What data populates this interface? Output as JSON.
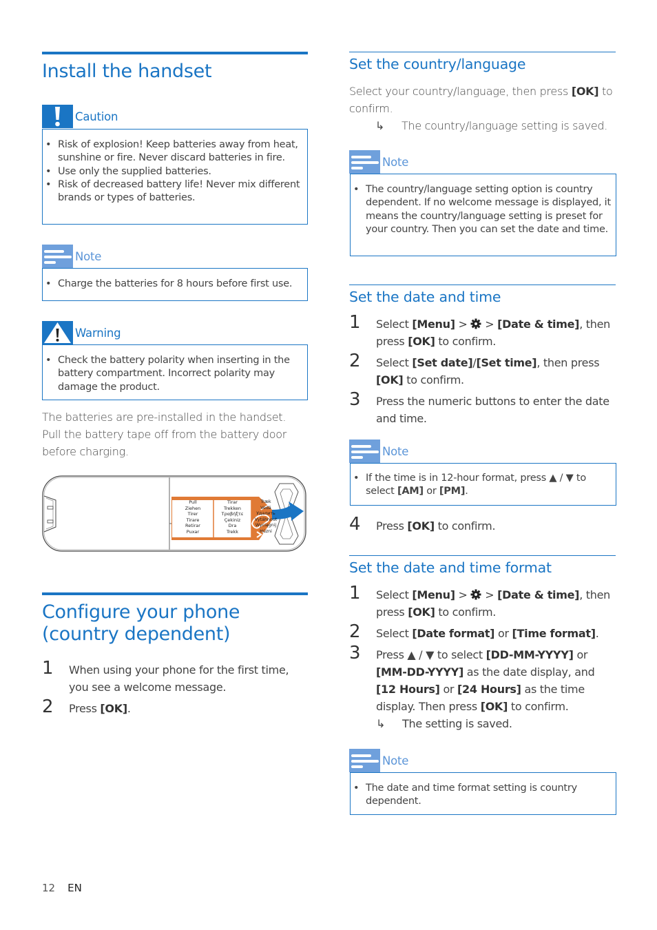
{
  "install": {
    "title": "Install the handset",
    "caution": {
      "label": "Caution",
      "items": [
        "Risk of explosion! Keep batteries away from heat, sunshine or fire. Never discard batteries in fire.",
        "Use only the supplied batteries.",
        "Risk of decreased battery life! Never mix different brands or types of batteries."
      ]
    },
    "note": {
      "label": "Note",
      "items": [
        "Charge the batteries for 8 hours before first use."
      ]
    },
    "warning": {
      "label": "Warning",
      "items": [
        "Check the battery polarity when inserting in the battery compartment. Incorrect polarity may damage the product."
      ]
    },
    "paragraph": "The batteries are pre-installed in the handset. Pull the battery tape off from the battery door before charging.",
    "tape_labels": {
      "col1": [
        "Pull",
        "Ziehen",
        "Tirer",
        "Tirare",
        "Retirar",
        "Puxar"
      ],
      "col2": [
        "Tirar",
        "Trekken",
        "Τραβήξτε",
        "Çekiniz",
        "Dra",
        "Trekk"
      ],
      "col3": [
        "Træk",
        "Vedä",
        "Удалить",
        "Vytáhnout",
        "Wyciągnij",
        "Húzni"
      ]
    }
  },
  "configure": {
    "title_line1": "Configure your phone",
    "title_line2": "(country dependent)",
    "steps": [
      {
        "num": "1",
        "text": "When using your phone for the first time, you see a welcome message."
      },
      {
        "num": "2",
        "pre": "Press ",
        "bold": "[OK]",
        "post": "."
      }
    ]
  },
  "country": {
    "title": "Set the country/language",
    "text_pre": "Select your country/language, then press ",
    "text_bold": "[OK]",
    "text_post": " to confirm.",
    "result_arrow": "↳",
    "result": "The country/language setting is saved.",
    "note": {
      "label": "Note",
      "items": [
        "The country/language setting option is country dependent. If no welcome message is displayed, it means the country/language setting is preset for your country. Then you can set the date and time."
      ]
    }
  },
  "datetime": {
    "title": "Set the date and time",
    "steps": [
      {
        "num": "1",
        "a": "Select ",
        "b1": "[Menu]",
        "c": " > ",
        "d": " > ",
        "b2": "[Date & time]",
        "e": ", then press ",
        "b3": "[OK]",
        "f": " to confirm."
      },
      {
        "num": "2",
        "a": "Select ",
        "b1": "[Set date]",
        "c": "/",
        "b2": "[Set time]",
        "d": ", then press ",
        "b3": "[OK]",
        "e": " to confirm."
      },
      {
        "num": "3",
        "text": "Press the numeric buttons to enter the date and time."
      },
      {
        "num": "4",
        "a": "Press ",
        "b1": "[OK]",
        "c": " to confirm."
      }
    ],
    "note": {
      "label": "Note",
      "a": "If the time is in 12-hour format, press ▲ / ▼ to select ",
      "b1": "[AM]",
      "c": " or ",
      "b2": "[PM]",
      "d": "."
    }
  },
  "format": {
    "title": "Set the date and time format",
    "steps": [
      {
        "num": "1",
        "a": "Select ",
        "b1": "[Menu]",
        "c": " > ",
        "d": " > ",
        "b2": "[Date & time]",
        "e": ", then press ",
        "b3": "[OK]",
        "f": " to confirm."
      },
      {
        "num": "2",
        "a": "Select ",
        "b1": "[Date format]",
        "c": " or ",
        "b2": "[Time format]",
        "d": "."
      },
      {
        "num": "3",
        "a": "Press ▲ / ▼ to select ",
        "b1": "[DD-MM-YYYY]",
        "c": " or ",
        "b2": "[MM-DD-YYYY]",
        "d": " as the date display, and ",
        "b3": "[12 Hours]",
        "e": " or ",
        "b4": "[24 Hours]",
        "f": " as the time display. Then press ",
        "b5": "[OK]",
        "g": " to confirm."
      }
    ],
    "result_arrow": "↳",
    "result": "The setting is saved.",
    "note": {
      "label": "Note",
      "items": [
        "The date and time format setting is country dependent."
      ]
    }
  },
  "footer": {
    "page": "12",
    "lang": "EN"
  },
  "colors": {
    "accent": "#1a75c4",
    "note_icon": "#6fa0dc",
    "tape_orange": "#e07a35"
  }
}
